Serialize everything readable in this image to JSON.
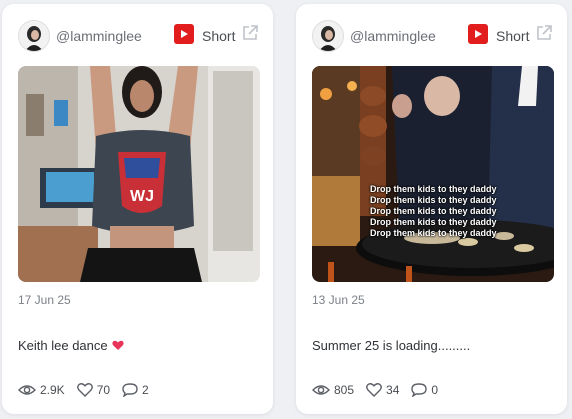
{
  "cards": [
    {
      "username": "@lamminglee",
      "platform_label": "Short",
      "date": "17 Jun 25",
      "caption": "Keith lee dance",
      "stats": {
        "views": "2.9K",
        "likes": "70",
        "comments": "2"
      },
      "icons": {
        "platform": "youtube-icon",
        "external": "external-link-icon"
      }
    },
    {
      "username": "@lamminglee",
      "platform_label": "Short",
      "date": "13 Jun 25",
      "caption": "Summer 25 is loading.........",
      "overlay_text": [
        "Drop them kids to they daddy",
        "Drop them kids to they daddy",
        "Drop them kids to they daddy",
        "Drop them kids to they daddy",
        "Drop them kids to they daddy"
      ],
      "stats": {
        "views": "805",
        "likes": "34",
        "comments": "0"
      },
      "icons": {
        "platform": "youtube-icon",
        "external": "external-link-icon"
      }
    }
  ],
  "colors": {
    "youtube_red": "#e11d1d",
    "heart_emoji": "#e8345a"
  }
}
